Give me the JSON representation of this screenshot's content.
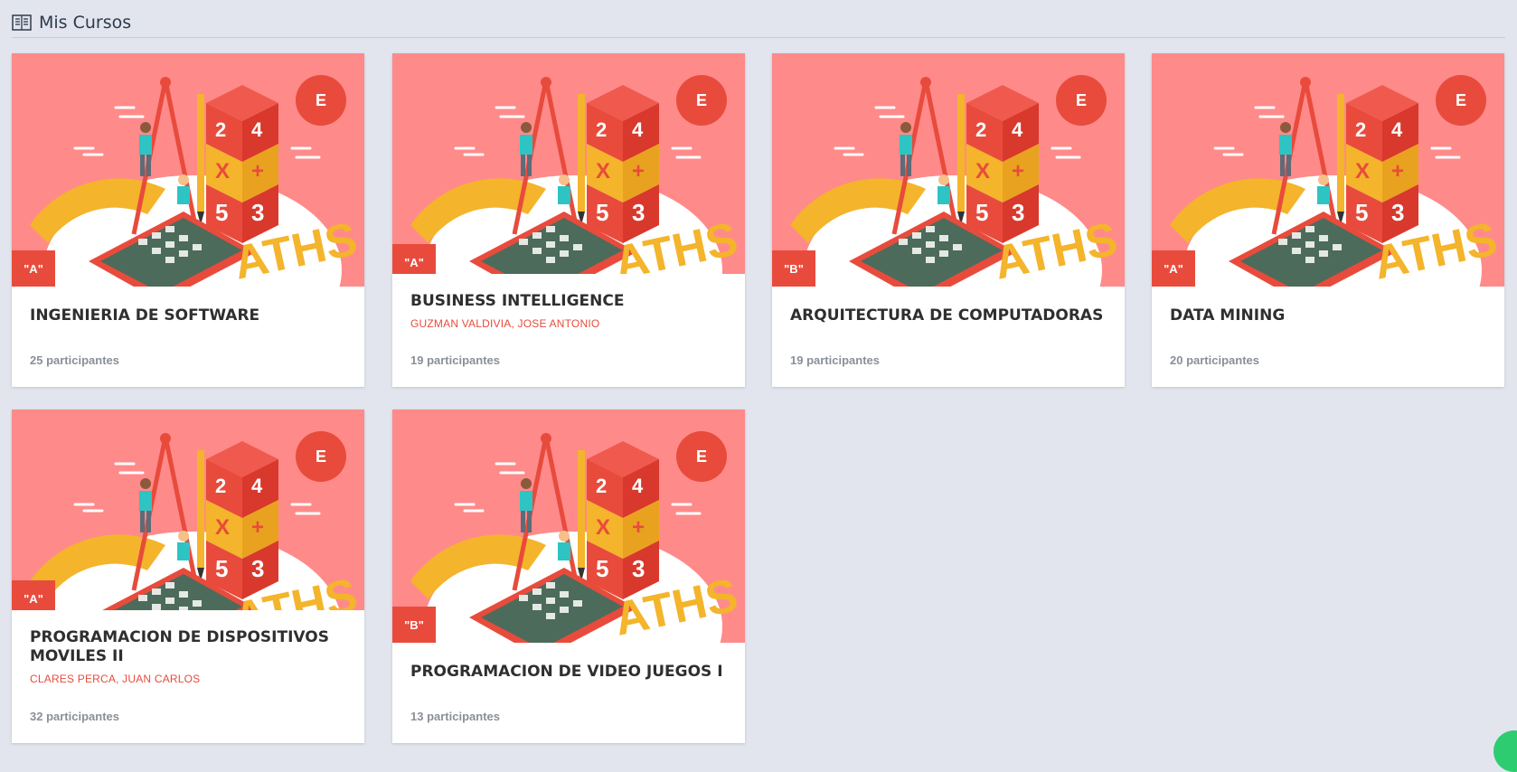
{
  "header": {
    "title": "Mis Cursos",
    "icon": "book-list-icon"
  },
  "badge_letter": "E",
  "courses": [
    {
      "title": "INGENIERIA DE SOFTWARE",
      "section": "\"A\"",
      "teacher": "",
      "participants": "25 participantes"
    },
    {
      "title": "BUSINESS INTELLIGENCE",
      "section": "\"A\"",
      "teacher": "GUZMAN VALDIVIA, JOSE ANTONIO",
      "participants": "19 participantes"
    },
    {
      "title": "ARQUITECTURA DE COMPUTADORAS",
      "section": "\"B\"",
      "teacher": "",
      "participants": "19 participantes"
    },
    {
      "title": "DATA MINING",
      "section": "\"A\"",
      "teacher": "",
      "participants": "20 participantes"
    },
    {
      "title": "PROGRAMACION DE DISPOSITIVOS MOVILES II",
      "section": "\"A\"",
      "teacher": "CLARES PERCA, JUAN CARLOS",
      "participants": "32 participantes"
    },
    {
      "title": "PROGRAMACION DE VIDEO JUEGOS I",
      "section": "\"B\"",
      "teacher": "",
      "participants": "13 participantes"
    }
  ],
  "colors": {
    "accent": "#e84b3c",
    "banner": "#ff8a8a",
    "background": "#e2e5ee"
  }
}
